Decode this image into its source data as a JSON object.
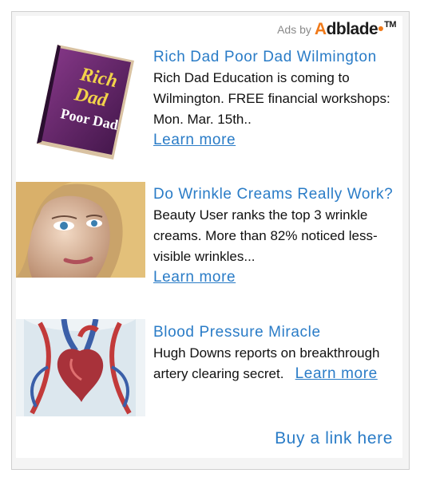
{
  "header": {
    "ads_by": "Ads by",
    "brand_first": "A",
    "brand_rest": "dblade",
    "brand_tm": "TM"
  },
  "ads": [
    {
      "title": "Rich Dad Poor Dad Wilmington",
      "description": "Rich Dad Education is coming to Wilmington. FREE financial workshops: Mon. Mar. 15th..",
      "link": "Learn more",
      "book_line1": "Rich",
      "book_line2": "Dad",
      "book_line3": "Poor Dad"
    },
    {
      "title": "Do Wrinkle Creams Really Work?",
      "description": "Beauty User ranks the top 3 wrinkle creams. More than 82% noticed less-visible wrinkles...",
      "link": "Learn more"
    },
    {
      "title": "Blood Pressure Miracle",
      "description": "Hugh Downs reports on breakthrough artery clearing secret.",
      "link": "Learn more"
    }
  ],
  "footer": {
    "buy_link": "Buy a link here"
  },
  "colors": {
    "link": "#2a7cc7",
    "brand_accent": "#f07a1a"
  }
}
